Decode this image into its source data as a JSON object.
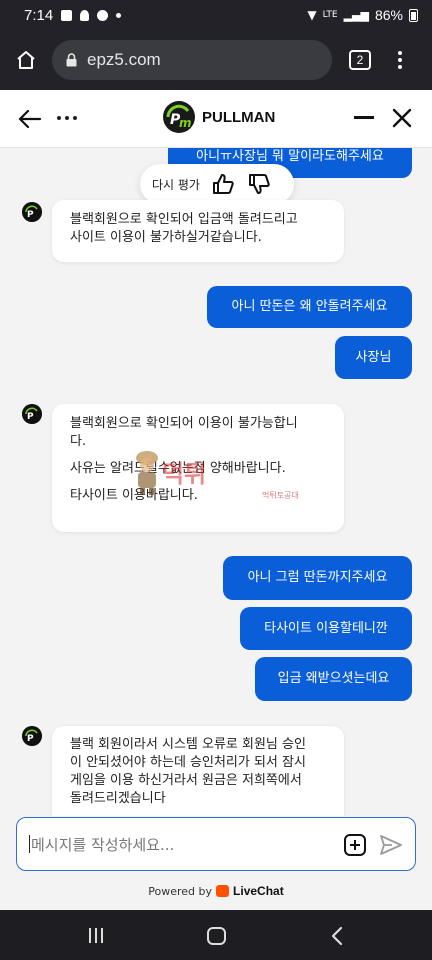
{
  "status_bar": {
    "time": "7:14",
    "network": "LTE",
    "battery": "86%"
  },
  "browser": {
    "url": "epz5.com",
    "tab_count": "2"
  },
  "chat_header": {
    "brand": "PULLMAN"
  },
  "rating": {
    "label": "다시 평가"
  },
  "messages": {
    "out_partial": "아니ㅠ사장님 뭐 말이라도해주세요",
    "in1_line1": "블랙회원으로 확인되어 입금액 돌려드리고",
    "in1_line2": "사이트 이용이 불가하실거같습니다.",
    "out1": "아니 딴돈은 왜 안돌려주세요",
    "out2": "사장님",
    "in2_line1": "블랙회원으로 확인되어 이용이 불가능합니",
    "in2_line2": "다.",
    "in2_line3": "사유는 알려드릴수없는점 양해바랍니다.",
    "in2_line4": "타사이트 이용바랍니다.",
    "out3": "아니 그럼 딴돈까지주세요",
    "out4": "타사이트 이용할테니깐",
    "out5": "입금 왜받으셧는데요",
    "in3_line1": "블랙 회원이라서 시스템 오류로 회원님 승인",
    "in3_line2": "이 안되셨어야 하는데 승인처리가 되서 잠시",
    "in3_line3": "게임을 이용 하신거라서 원금은 저희쪽에서",
    "in3_line4": "돌려드리겠습니다"
  },
  "watermark": {
    "text": "먹튀",
    "sub": "먹튀토공대"
  },
  "composer": {
    "placeholder": "메시지를 작성하세요..."
  },
  "footer": {
    "powered_by": "Powered by",
    "brand": "LiveChat"
  },
  "colors": {
    "accent": "#0a5ed7",
    "header_dark": "#222228",
    "logo_green": "#7ed321"
  },
  "icons": [
    "home-icon",
    "lock-icon",
    "tabs-icon",
    "kebab-menu-icon",
    "back-arrow-icon",
    "more-icon",
    "minimize-icon",
    "close-icon",
    "thumbs-up-icon",
    "thumbs-down-icon",
    "emoji-add-icon",
    "send-icon"
  ]
}
